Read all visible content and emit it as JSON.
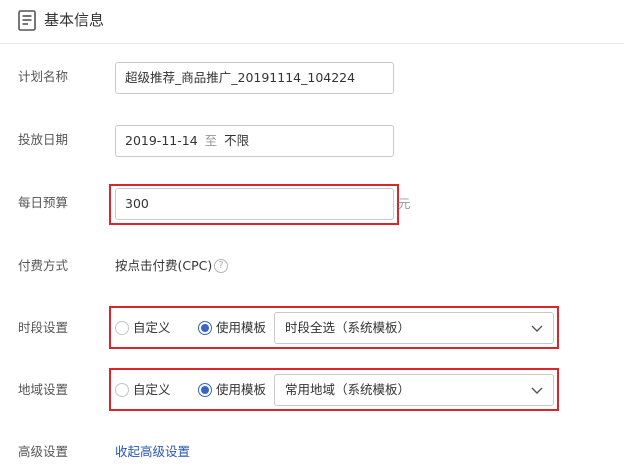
{
  "header": {
    "title": "基本信息",
    "icon": "document-icon"
  },
  "plan_name": {
    "label": "计划名称",
    "value": "超级推荐_商品推广_20191114_104224"
  },
  "date": {
    "label": "投放日期",
    "start": "2019-11-14",
    "separator": "至",
    "end": "不限"
  },
  "budget": {
    "label": "每日预算",
    "value": "300",
    "unit": "元"
  },
  "payment": {
    "label": "付费方式",
    "value": "按点击付费(CPC)",
    "help_icon": "question-circle-icon"
  },
  "time_setting": {
    "label": "时段设置",
    "options": [
      "自定义",
      "使用模板"
    ],
    "selected_option": "使用模板",
    "template_value": "时段全选（系统模板）"
  },
  "region_setting": {
    "label": "地域设置",
    "options": [
      "自定义",
      "使用模板"
    ],
    "selected_option": "使用模板",
    "template_value": "常用地域（系统模板）"
  },
  "advanced": {
    "label": "高级设置",
    "link_text": "收起高级设置"
  },
  "colors": {
    "highlight_frame": "#d9262c",
    "accent": "#3a64c6",
    "link": "#2a56b3"
  }
}
